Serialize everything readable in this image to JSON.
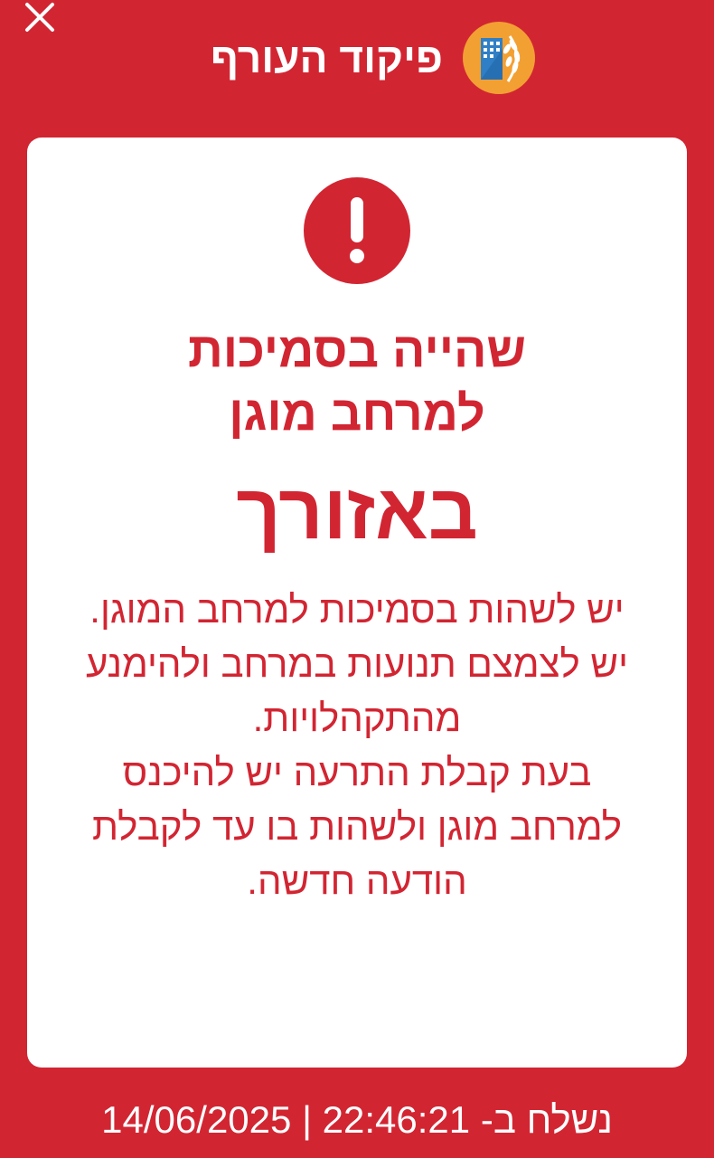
{
  "header": {
    "app_title": "פיקוד העורף",
    "close_icon": "close-icon",
    "logo_icon": "home-front-command-logo"
  },
  "colors": {
    "brand_red": "#D22532",
    "card_bg": "#FFFFFF",
    "logo_orange": "#F3A033",
    "logo_blue": "#2F7FC6"
  },
  "alert": {
    "icon": "exclamation-icon",
    "title_line1": "שהייה בסמיכות",
    "title_line2": "למרחב מוגן",
    "area": "באזורך",
    "body_lines": [
      "יש לשהות בסמיכות למרחב המוגן.",
      "יש לצמצם תנועות במרחב ולהימנע מהתקהלויות.",
      "בעת קבלת התרעה יש להיכנס למרחב מוגן ולשהות בו עד לקבלת הודעה חדשה."
    ]
  },
  "footer": {
    "sent_label": "נשלח ב-",
    "time": "22:46:21",
    "separator": "|",
    "date": "14/06/2025"
  }
}
